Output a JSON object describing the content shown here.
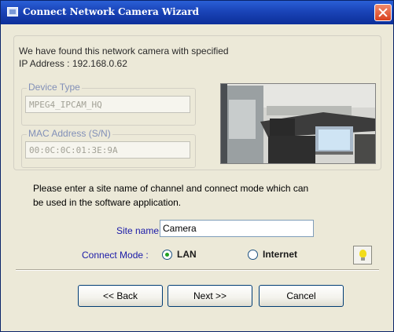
{
  "window": {
    "title": "Connect Network Camera Wizard",
    "close_icon": "close-icon"
  },
  "found": {
    "line1": "We have found this network camera with specified",
    "line2": "IP Address : 192.168.0.62"
  },
  "device_type": {
    "label": "Device Type",
    "value": "MPEG4_IPCAM_HQ"
  },
  "mac_address": {
    "label": "MAC Address (S/N)",
    "value": "00:0C:0C:01:3E:9A"
  },
  "instructions": {
    "line1": "Please enter a site name of channel and connect mode which can",
    "line2": "be used in the software application."
  },
  "site": {
    "label": "Site name :",
    "value": "Camera"
  },
  "connect_mode": {
    "label": "Connect Mode :",
    "options": [
      {
        "label": "LAN",
        "selected": true
      },
      {
        "label": "Internet",
        "selected": false
      }
    ]
  },
  "buttons": {
    "back": "<< Back",
    "next": "Next >>",
    "cancel": "Cancel"
  },
  "colors": {
    "title_bar": "#1a44b8",
    "label_blue": "#1a1aa8",
    "group_legend": "#8290b8",
    "radio_dot": "#21a121"
  }
}
